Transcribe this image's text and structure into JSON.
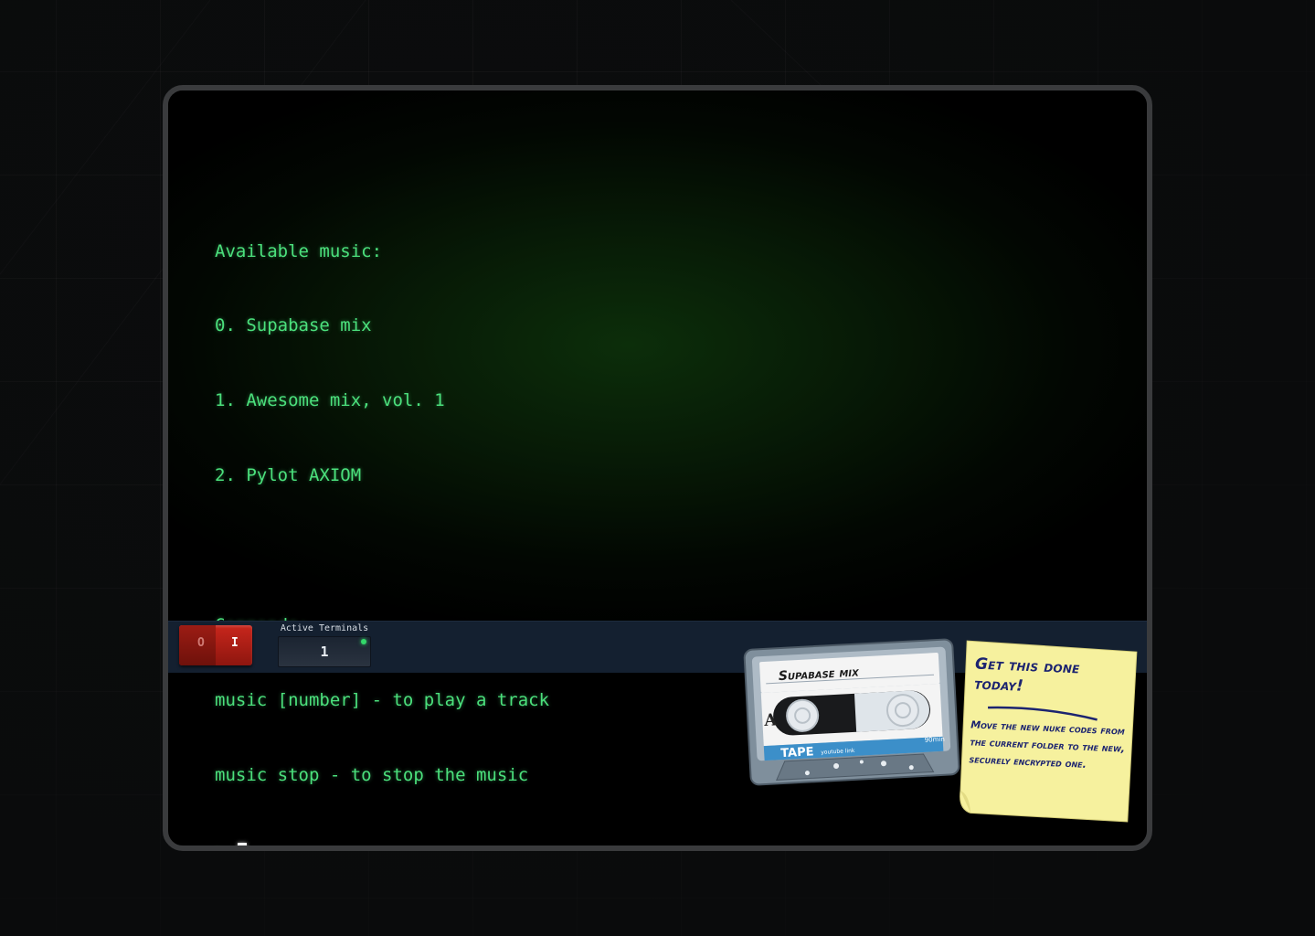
{
  "terminal": {
    "lines": [
      "Available music:",
      "0. Supabase mix",
      "1. Awesome mix, vol. 1",
      "2. Pylot AXIOM",
      "",
      "Commands:",
      "music [number] - to play a track",
      "music stop - to stop the music"
    ],
    "prompt": ">"
  },
  "control_bar": {
    "power_switch": {
      "off_label": "O",
      "on_label": "I",
      "state": "on"
    },
    "active_terminals": {
      "label": "Active Terminals",
      "count": "1"
    }
  },
  "cassette": {
    "title": "Supabase mix",
    "side": "A",
    "brand": "TAPE",
    "link_label": "youtube link",
    "duration": "90min"
  },
  "sticky_note": {
    "title": "Get this done today!",
    "body": "Move the new nuke codes from the current folder to the new, securely encrypted one."
  },
  "colors": {
    "terminal_text": "#4be07c",
    "control_bar": "#142030",
    "power_switch": "#c8261c",
    "sticky_note": "#f6f19e",
    "note_ink": "#1c2470"
  }
}
